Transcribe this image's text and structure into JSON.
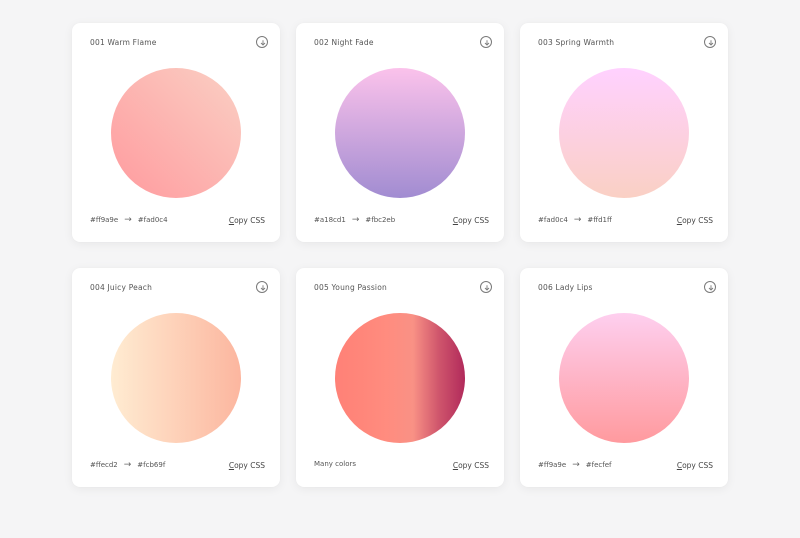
{
  "cards": [
    {
      "title": "001 Warm Flame",
      "gradient": {
        "direction": "45deg",
        "colors": [
          "#ff9a9e",
          "#fad0c4"
        ]
      },
      "from": "#ff9a9e",
      "arrow": "→",
      "to": "#fad0c4",
      "copy_label": "Copy CSS",
      "download_icon": "download-circle-icon"
    },
    {
      "title": "002 Night Fade",
      "gradient": {
        "direction": "to top",
        "colors": [
          "#a18cd1",
          "#fbc2eb"
        ]
      },
      "from": "#a18cd1",
      "arrow": "→",
      "to": "#fbc2eb",
      "copy_label": "Copy CSS",
      "download_icon": "download-circle-icon"
    },
    {
      "title": "003 Spring Warmth",
      "gradient": {
        "direction": "to top",
        "colors": [
          "#fad0c4",
          "#ffd1ff"
        ]
      },
      "from": "#fad0c4",
      "arrow": "→",
      "to": "#ffd1ff",
      "copy_label": "Copy CSS",
      "download_icon": "download-circle-icon"
    },
    {
      "title": "004 Juicy Peach",
      "gradient": {
        "direction": "to right",
        "colors": [
          "#ffecd2",
          "#fcb69f"
        ]
      },
      "from": "#ffecd2",
      "arrow": "→",
      "to": "#fcb69f",
      "copy_label": "Copy CSS",
      "download_icon": "download-circle-icon"
    },
    {
      "title": "005 Young Passion",
      "gradient": {
        "direction": "to right",
        "colors": [
          "#ff8177",
          "#ff867a",
          "#ff8c7f",
          "#f99185",
          "#cf556c",
          "#b12a5b"
        ]
      },
      "label": "Many colors",
      "copy_label": "Copy CSS",
      "download_icon": "download-circle-icon"
    },
    {
      "title": "006 Lady Lips",
      "gradient": {
        "direction": "to top",
        "colors": [
          "#ff9a9e",
          "#fecfef"
        ]
      },
      "from": "#ff9a9e",
      "arrow": "→",
      "to": "#fecfef",
      "copy_label": "Copy CSS",
      "download_icon": "download-circle-icon"
    }
  ]
}
